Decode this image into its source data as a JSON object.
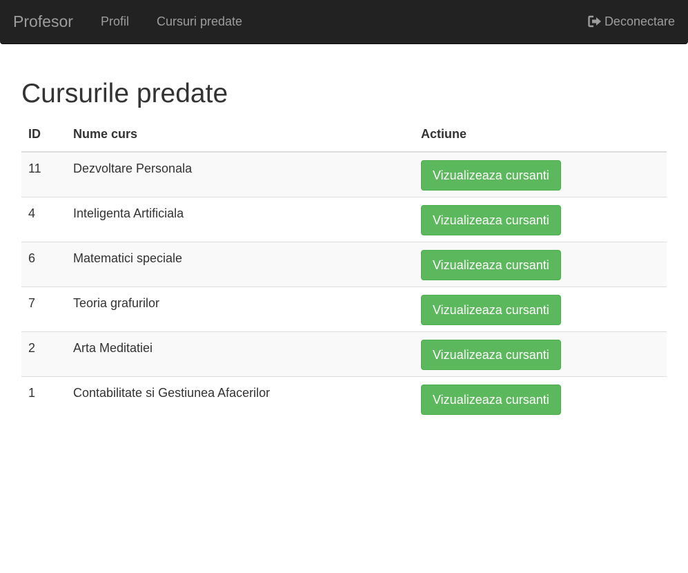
{
  "navbar": {
    "brand": "Profesor",
    "links": [
      "Profil",
      "Cursuri predate"
    ],
    "logout_label": "Deconectare",
    "logout_icon": "logout-icon"
  },
  "page": {
    "title": "Cursurile predate"
  },
  "table": {
    "headers": [
      "ID",
      "Nume curs",
      "Actiune"
    ],
    "rows": [
      {
        "id": "11",
        "name": "Dezvoltare Personala",
        "action": "Vizualizeaza cursanti"
      },
      {
        "id": "4",
        "name": "Inteligenta Artificiala",
        "action": "Vizualizeaza cursanti"
      },
      {
        "id": "6",
        "name": "Matematici speciale",
        "action": "Vizualizeaza cursanti"
      },
      {
        "id": "7",
        "name": "Teoria grafurilor",
        "action": "Vizualizeaza cursanti"
      },
      {
        "id": "2",
        "name": "Arta Meditatiei",
        "action": "Vizualizeaza cursanti"
      },
      {
        "id": "1",
        "name": "Contabilitate si Gestiunea Afacerilor",
        "action": "Vizualizeaza cursanti"
      }
    ]
  },
  "colors": {
    "navbar_bg": "#222222",
    "nav_text": "#9d9d9d",
    "button_success": "#5cb85c",
    "striped_row": "#f9f9f9"
  }
}
